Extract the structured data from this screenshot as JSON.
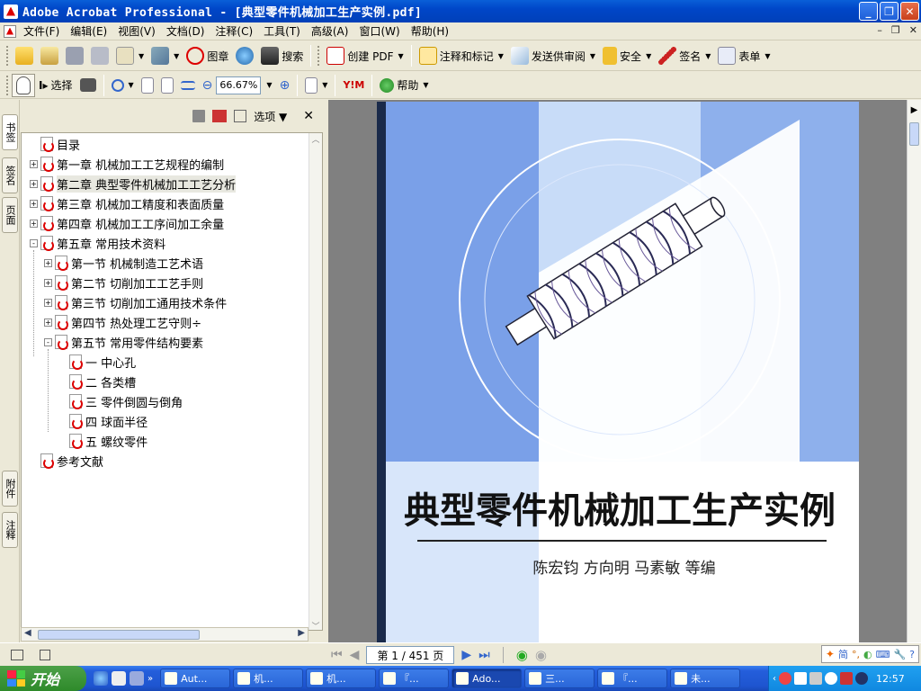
{
  "window": {
    "title": "Adobe Acrobat Professional - [典型零件机械加工生产实例.pdf]"
  },
  "menubar": {
    "items": [
      "文件(F)",
      "编辑(E)",
      "视图(V)",
      "文档(D)",
      "注释(C)",
      "工具(T)",
      "高级(A)",
      "窗口(W)",
      "帮助(H)"
    ]
  },
  "toolbar1": {
    "stamp": "图章",
    "search": "搜索",
    "create_pdf": "创建 PDF",
    "comment": "注释和标记",
    "send_review": "发送供审阅",
    "security": "安全",
    "sign": "签名",
    "forms": "表单"
  },
  "toolbar2": {
    "select": "选择",
    "zoom_value": "66.67%",
    "help": "帮助"
  },
  "side_tabs": [
    "书签",
    "签名",
    "页面",
    "附件",
    "注释"
  ],
  "nav_panel": {
    "options_label": "选项"
  },
  "bookmarks": [
    {
      "label": "目录",
      "level": 0,
      "expander": ""
    },
    {
      "label": "第一章 机械加工工艺规程的编制",
      "level": 0,
      "expander": "+"
    },
    {
      "label": "第二章 典型零件机械加工工艺分析",
      "level": 0,
      "expander": "+",
      "selected": true
    },
    {
      "label": "第三章 机械加工精度和表面质量",
      "level": 0,
      "expander": "+"
    },
    {
      "label": "第四章 机械加工工序间加工余量",
      "level": 0,
      "expander": "+"
    },
    {
      "label": "第五章 常用技术资料",
      "level": 0,
      "expander": "-"
    },
    {
      "label": "第一节 机械制造工艺术语",
      "level": 1,
      "expander": "+"
    },
    {
      "label": "第二节 切削加工工艺手则",
      "level": 1,
      "expander": "+"
    },
    {
      "label": "第三节 切削加工通用技术条件",
      "level": 1,
      "expander": "+"
    },
    {
      "label": "第四节 热处理工艺守则÷",
      "level": 1,
      "expander": "+"
    },
    {
      "label": "第五节 常用零件结构要素",
      "level": 1,
      "expander": "-"
    },
    {
      "label": "一 中心孔",
      "level": 2,
      "expander": ""
    },
    {
      "label": "二 各类槽",
      "level": 2,
      "expander": ""
    },
    {
      "label": "三 零件倒圆与倒角",
      "level": 2,
      "expander": ""
    },
    {
      "label": "四 球面半径",
      "level": 2,
      "expander": ""
    },
    {
      "label": "五 螺纹零件",
      "level": 2,
      "expander": ""
    },
    {
      "label": "参考文献",
      "level": 0,
      "expander": ""
    }
  ],
  "cover": {
    "title": "典型零件机械加工生产实例",
    "authors": "陈宏钧  方向明  马素敏    等编"
  },
  "statusbar": {
    "page_indicator": "第 1 / 451 页"
  },
  "taskbar": {
    "start_label": "开始",
    "tasks": [
      {
        "label": "Aut...",
        "active": false
      },
      {
        "label": "机...",
        "active": false
      },
      {
        "label": "机...",
        "active": false
      },
      {
        "label": "『...",
        "active": false
      },
      {
        "label": "Ado...",
        "active": true
      },
      {
        "label": "三...",
        "active": false
      },
      {
        "label": "『...",
        "active": false
      },
      {
        "label": "未...",
        "active": false
      }
    ],
    "clock": "12:57"
  }
}
